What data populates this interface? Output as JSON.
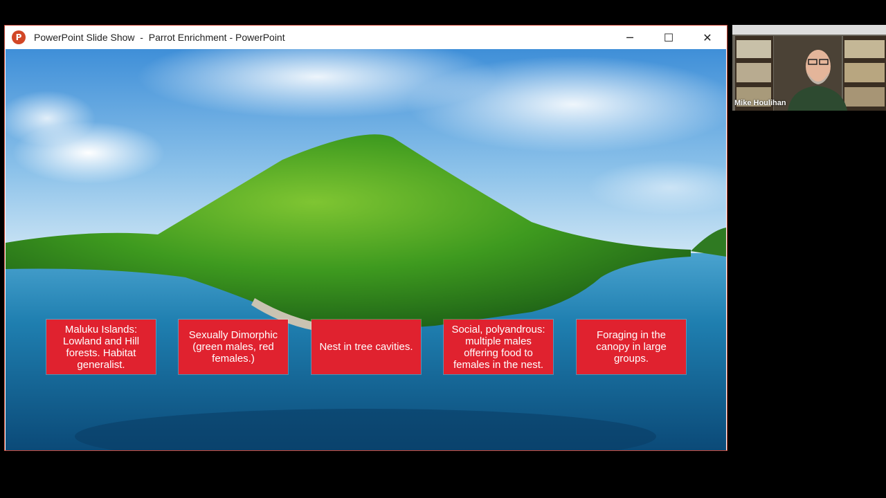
{
  "window": {
    "title": "PowerPoint Slide Show  -  Parrot Enrichment - PowerPoint",
    "app_icon_label": "P",
    "controls": {
      "minimize": "─",
      "maximize": "☐",
      "close": "✕"
    }
  },
  "slide": {
    "cards": [
      {
        "text": "Maluku Islands: Lowland and Hill forests. Habitat generalist."
      },
      {
        "text": "Sexually Dimorphic (green males, red females.)"
      },
      {
        "text": "Nest in tree cavities."
      },
      {
        "text": "Social, polyandrous: multiple males offering food to females in the nest."
      },
      {
        "text": "Foraging in the canopy in large groups."
      }
    ],
    "card_color": "#e0222f"
  },
  "video": {
    "participant_name": "Mike Houlihan"
  },
  "colors": {
    "window_border": "#c94a3a",
    "powerpoint_icon": "#d24726"
  }
}
